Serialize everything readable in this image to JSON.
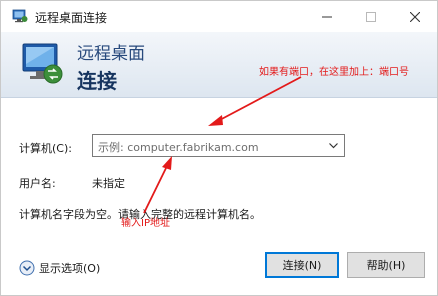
{
  "window": {
    "title": "远程桌面连接"
  },
  "banner": {
    "line1": "远程桌面",
    "line2": "连接"
  },
  "form": {
    "computer_label": "计算机(C):",
    "computer_placeholder": "示例: computer.fabrikam.com",
    "username_label": "用户名:",
    "username_value": "未指定",
    "hint_text": "计算机名字段为空。请输入完整的远程计算机名。"
  },
  "footer": {
    "show_options_label": "显示选项(O)",
    "connect_label": "连接(N)",
    "help_label": "帮助(H)"
  },
  "annotations": {
    "port_note": "如果有端口，在这里加上：端口号",
    "input_note": "输入IP地址"
  },
  "colors": {
    "annotation": "#e31a1a",
    "accent": "#0078d7",
    "banner_title": "#27497c"
  }
}
